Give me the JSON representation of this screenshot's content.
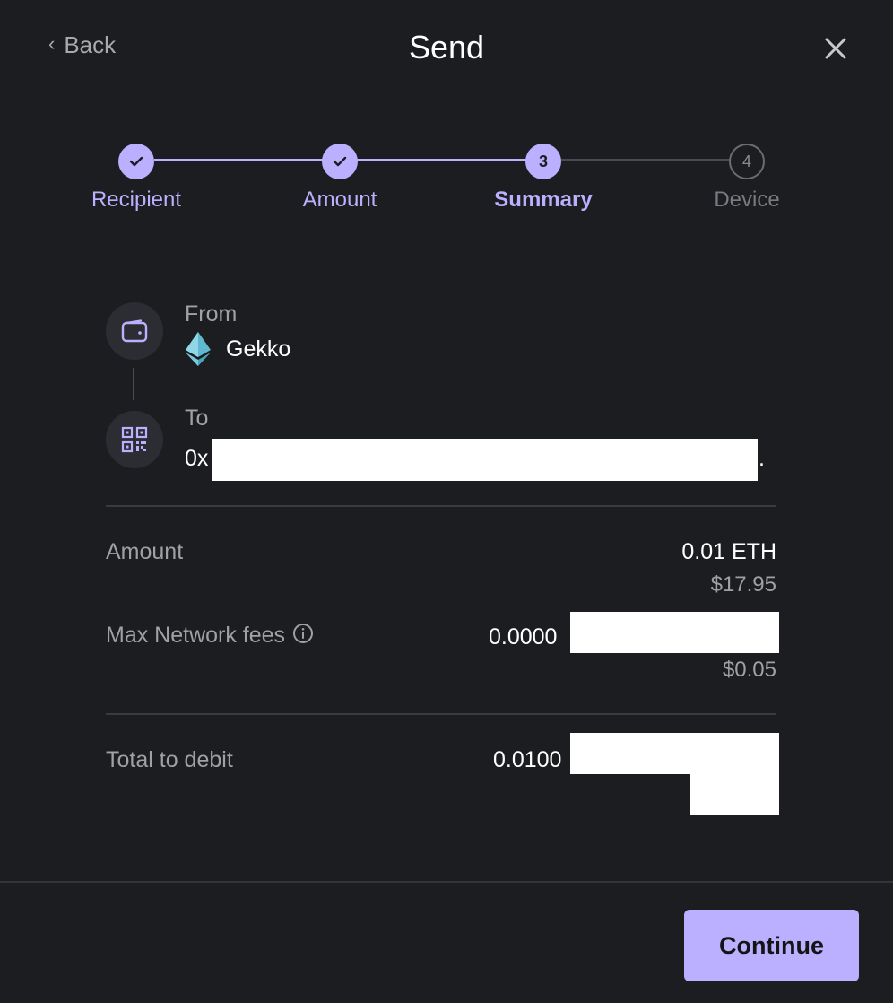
{
  "header": {
    "back_label": "Back",
    "title": "Send"
  },
  "stepper": {
    "steps": [
      {
        "label": "Recipient",
        "number": "1",
        "state": "done"
      },
      {
        "label": "Amount",
        "number": "2",
        "state": "done"
      },
      {
        "label": "Summary",
        "number": "3",
        "state": "active"
      },
      {
        "label": "Device",
        "number": "4",
        "state": "todo"
      }
    ]
  },
  "from": {
    "label": "From",
    "account": "Gekko",
    "icon": "wallet-icon",
    "currency_icon": "ethereum-icon"
  },
  "to": {
    "label": "To",
    "address_prefix": "0x",
    "address_suffix": ".",
    "icon": "qr-code-icon"
  },
  "amount": {
    "label": "Amount",
    "crypto": "0.01 ETH",
    "fiat": "$17.95"
  },
  "fees": {
    "label": "Max Network fees",
    "crypto_prefix": "0.0000",
    "fiat": "$0.05",
    "icon": "info-icon"
  },
  "total": {
    "label": "Total to debit",
    "crypto_prefix": "0.0100"
  },
  "footer": {
    "continue_label": "Continue"
  },
  "colors": {
    "background": "#1c1d20",
    "accent": "#bbb0ff",
    "muted_text": "#a0a0a5"
  }
}
